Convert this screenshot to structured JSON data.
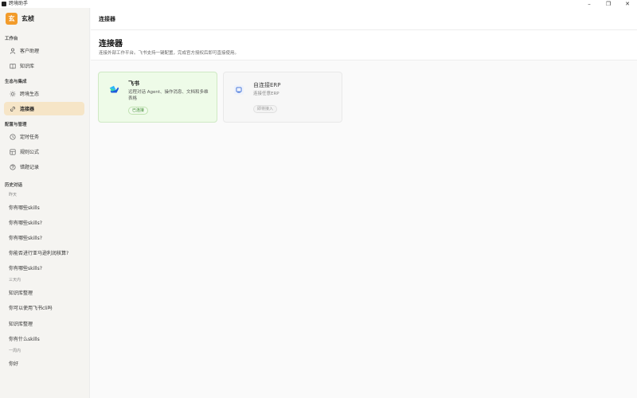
{
  "window": {
    "title": "跨境助手",
    "minimize": "–",
    "maximize": "❐",
    "close": "✕"
  },
  "brand": {
    "logo": "玄",
    "name": "玄桢"
  },
  "sidebar": {
    "sections": [
      {
        "title": "工作台",
        "items": [
          {
            "label": "客户助理",
            "icon": "person-icon"
          },
          {
            "label": "知识库",
            "icon": "book-icon"
          }
        ]
      },
      {
        "title": "生态与集成",
        "items": [
          {
            "label": "跨境生态",
            "icon": "sun-icon"
          },
          {
            "label": "连接器",
            "icon": "link-icon",
            "active": true
          }
        ]
      },
      {
        "title": "配置与管理",
        "items": [
          {
            "label": "定时任务",
            "icon": "clock-icon"
          },
          {
            "label": "规则公式",
            "icon": "grid-icon"
          },
          {
            "label": "错题记录",
            "icon": "question-icon"
          }
        ]
      }
    ],
    "history": {
      "title": "历史对话",
      "groups": [
        {
          "label": "昨天",
          "items": [
            "你有哪些skills",
            "你有哪些skills?",
            "你有哪些skills?",
            "你能否进行亚马逊利润核算?",
            "你有哪些skills?"
          ]
        },
        {
          "label": "三天内",
          "items": [
            "知识库整理",
            "你可以使用飞书cli吗",
            "知识库整理",
            "你有什么skills"
          ]
        },
        {
          "label": "一周内",
          "items": [
            "你好"
          ]
        }
      ]
    }
  },
  "header": {
    "title": "连接器"
  },
  "hero": {
    "title": "连接器",
    "description": "连接外部工作平台。飞书支持一键配置，完成官方授权后即可直接使用。"
  },
  "connectors": [
    {
      "name": "飞书",
      "description": "远程对话 Agent、操作消息、文档和多维表格",
      "status": "已连接",
      "icon": "feishu-icon",
      "state": "connected"
    },
    {
      "name": "自连接ERP",
      "description": "连接任意ERP",
      "status": "即将接入",
      "icon": "erp-icon",
      "state": "disabled"
    }
  ],
  "colors": {
    "accent": "#f29b2a",
    "active_bg": "#f6e5c7",
    "connected_bg": "#eefbe8",
    "connected_text": "#3a8a2c"
  }
}
